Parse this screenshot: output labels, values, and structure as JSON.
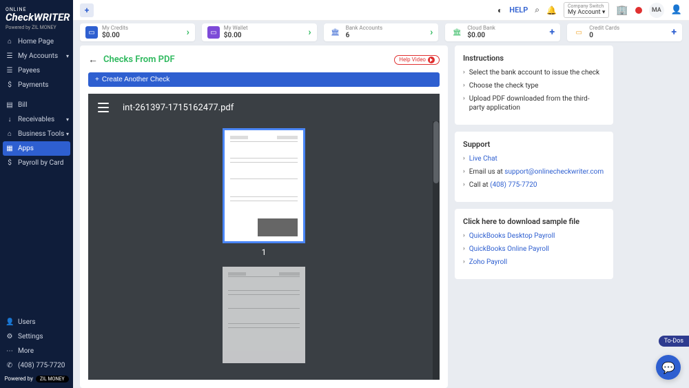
{
  "brand": {
    "online": "ONLINE",
    "name": "CheckWRITER",
    "powered": "Powered by ZIL MONEY"
  },
  "topbar": {
    "help": "HELP",
    "company_switch_label": "Company Switch",
    "company_switch_value": "My Account",
    "avatar": "MA"
  },
  "sidebar": {
    "items": [
      {
        "icon": "⌂",
        "label": "Home Page"
      },
      {
        "icon": "☰",
        "label": "My Accounts",
        "caret": true
      },
      {
        "icon": "☰",
        "label": "Payees"
      },
      {
        "icon": "$",
        "label": "Payments"
      }
    ],
    "group2": [
      {
        "icon": "▤",
        "label": "Bill"
      },
      {
        "icon": "↓",
        "label": "Receivables",
        "caret": true
      },
      {
        "icon": "⌂",
        "label": "Business Tools",
        "caret": true
      },
      {
        "icon": "▦",
        "label": "Apps",
        "active": true
      },
      {
        "icon": "$",
        "label": "Payroll by Card"
      }
    ],
    "bottom": [
      {
        "icon": "👤",
        "label": "Users"
      },
      {
        "icon": "⚙",
        "label": "Settings"
      },
      {
        "icon": "⋯",
        "label": "More"
      },
      {
        "icon": "✆",
        "label": "(408) 775-7720"
      }
    ],
    "poweredby": "Powered by"
  },
  "cards": [
    {
      "icon_bg": "#2e5fd0",
      "icon": "▭",
      "label": "My Credits",
      "value": "$0.00",
      "action": "›",
      "chev": true
    },
    {
      "icon_bg": "#7d4ad8",
      "icon": "▭",
      "label": "My Wallet",
      "value": "$0.00",
      "action": "›",
      "chev": true
    },
    {
      "icon_bg": "#ffffff",
      "icon": "🏛",
      "icon_color": "#2e5fd0",
      "label": "Bank Accounts",
      "value": "6",
      "action": "›",
      "chev": true
    },
    {
      "icon_bg": "#ffffff",
      "icon": "🏛",
      "icon_color": "#2cb85c",
      "label": "Cloud Bank",
      "value": "$0.00",
      "action": "+"
    },
    {
      "icon_bg": "#ffffff",
      "icon": "▭",
      "icon_color": "#f0a020",
      "label": "Credit Cards",
      "value": "0",
      "action": "+"
    }
  ],
  "page": {
    "title": "Checks From PDF",
    "help_video": "Help Video",
    "create_btn": "Create Another Check",
    "pdf_filename": "int-261397-1715162477.pdf",
    "page1_num": "1"
  },
  "instructions": {
    "title": "Instructions",
    "items": [
      "Select the bank account to issue the check",
      "Choose the check type",
      "Upload PDF downloaded from the third-party application"
    ]
  },
  "support": {
    "title": "Support",
    "live_chat": "Live Chat",
    "email_prefix": "Email us at ",
    "email": "support@onlinecheckwriter.com",
    "call_prefix": "Call at ",
    "phone": "(408) 775-7720"
  },
  "samples": {
    "title": "Click here to download sample file",
    "items": [
      "QuickBooks Desktop Payroll",
      "QuickBooks Online Payroll",
      "Zoho Payroll"
    ]
  },
  "todos": "To-Dos"
}
